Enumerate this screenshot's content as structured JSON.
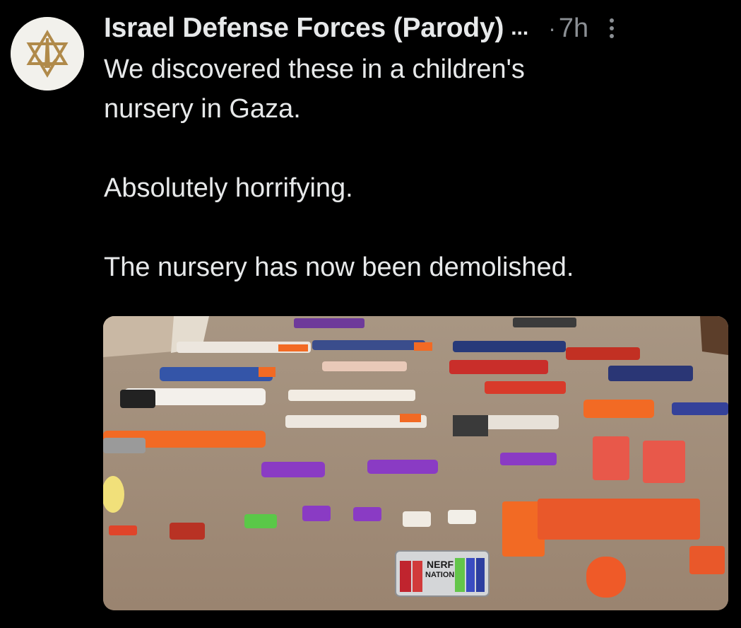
{
  "tweet": {
    "author_name": "Israel Defense Forces (Parody)",
    "truncation": "...",
    "separator": "·",
    "time": "7h",
    "lines": [
      "We discovered these in a children's",
      "nursery in Gaza.",
      "",
      "Absolutely horrifying.",
      "",
      "The nursery has now been demolished."
    ],
    "media": {
      "box_label_line1": "NERF",
      "box_label_line2": "NATION"
    }
  },
  "colors": {
    "background": "#000000",
    "text": "#e7e9ea",
    "muted": "#8b8f94",
    "carpet": "#a08b74",
    "blaster_orange": "#f26a24",
    "blaster_blue": "#2d3f9e",
    "blaster_purple": "#8a3bc4"
  },
  "icons": [
    "avatar-emblem-icon",
    "more-options-icon"
  ]
}
